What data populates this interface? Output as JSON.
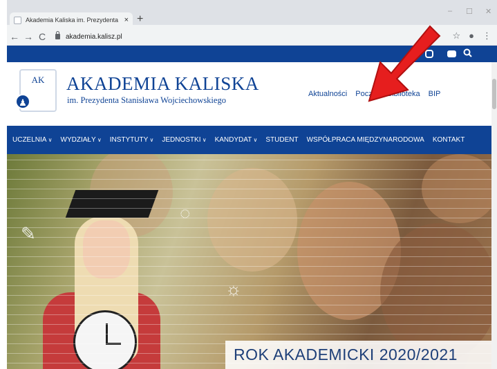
{
  "browser": {
    "tab_title": "Akademia Kaliska im. Prezydenta",
    "tab_close": "×",
    "new_tab": "+",
    "url": "akademia.kalisz.pl",
    "back": "←",
    "forward": "→",
    "reload": "C",
    "star": "☆",
    "menu": "⋮",
    "minimize": "–",
    "maximize": "☐",
    "close": "✕"
  },
  "header": {
    "title": "AKADEMIA KALISKA",
    "subtitle": "im. Prezydenta Stanisława Wojciechowskiego",
    "emblem_text": "AK",
    "links": [
      "Aktualności",
      "Poczta",
      "Biblioteka",
      "BIP"
    ]
  },
  "topbar": {
    "icons": [
      "instagram-icon",
      "youtube-icon",
      "search-icon"
    ]
  },
  "nav": {
    "items": [
      {
        "label": "UCZELNIA",
        "has_sub": true
      },
      {
        "label": "WYDZIAŁY",
        "has_sub": true
      },
      {
        "label": "INSTYTUTY",
        "has_sub": true
      },
      {
        "label": "JEDNOSTKI",
        "has_sub": true
      },
      {
        "label": "KANDYDAT",
        "has_sub": true
      },
      {
        "label": "STUDENT",
        "has_sub": false
      },
      {
        "label": "WSPÓŁPRACA MIĘDZYNARODOWA",
        "has_sub": false
      },
      {
        "label": "KONTAKT",
        "has_sub": false
      }
    ]
  },
  "hero": {
    "banner": "ROK AKADEMICKI 2020/2021"
  },
  "colors": {
    "brand_blue": "#0f4395",
    "arrow_red": "#e61e1e"
  }
}
